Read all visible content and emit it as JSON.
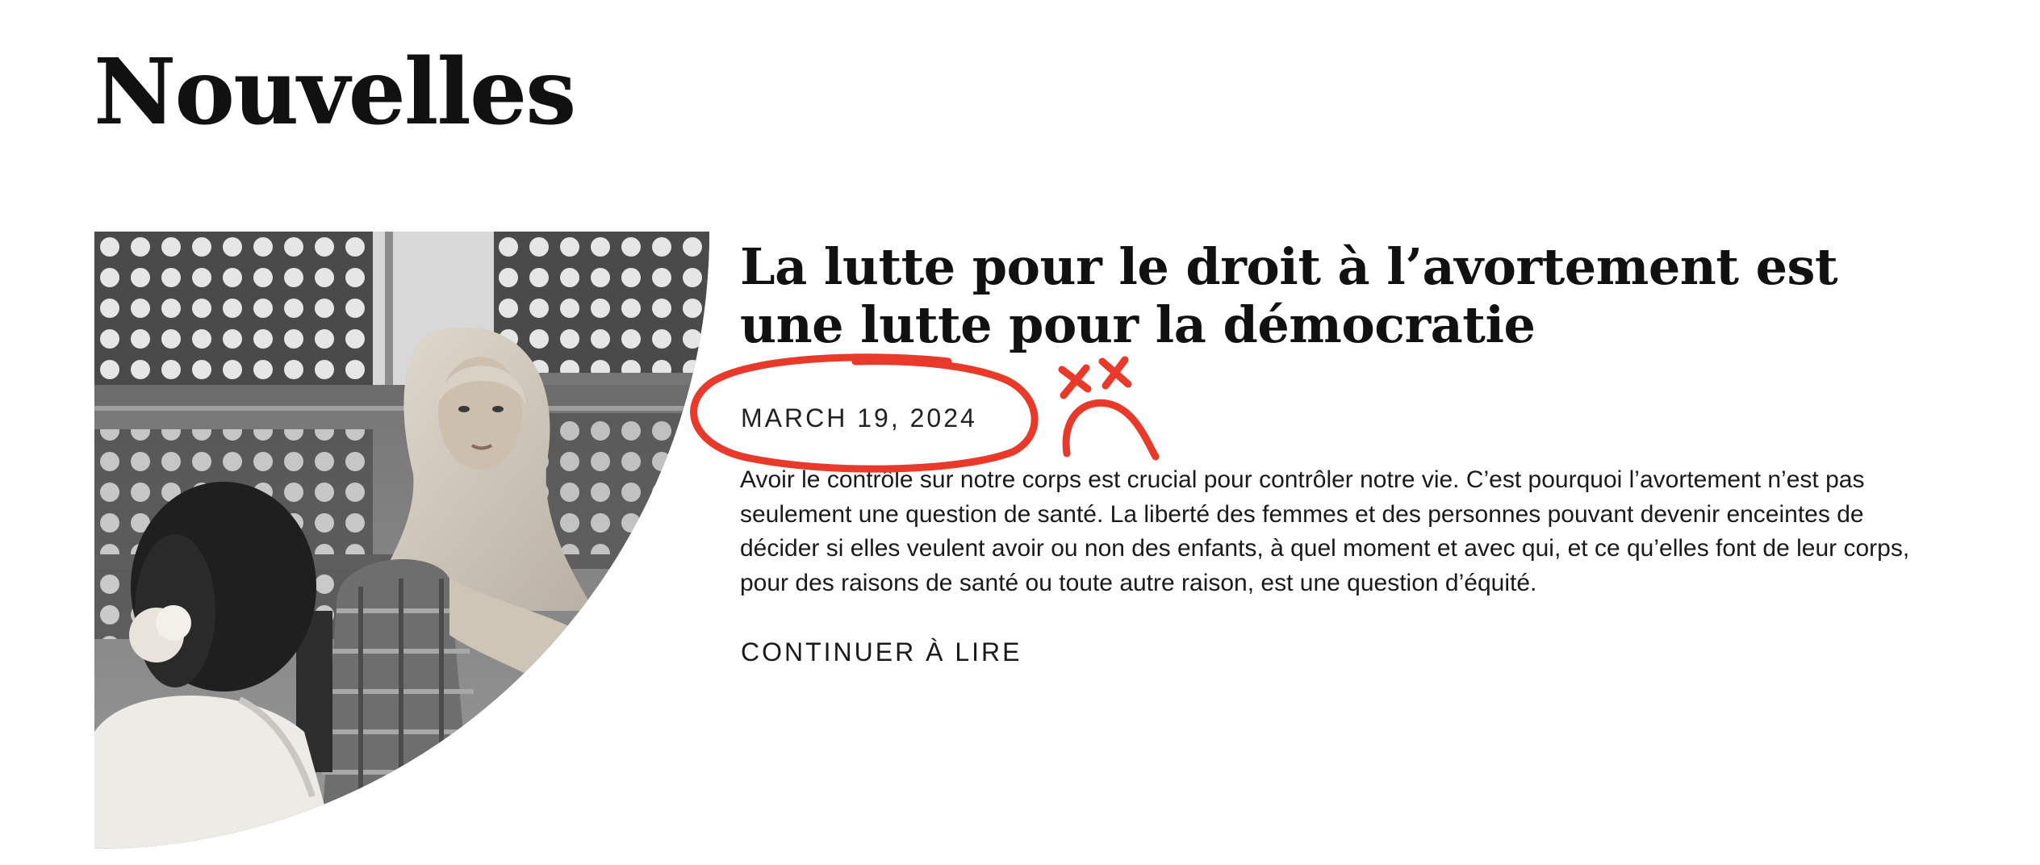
{
  "page": {
    "heading": "Nouvelles"
  },
  "article": {
    "title": "La lutte pour le droit à l’avortement est une lutte pour la démocratie",
    "date": "MARCH 19, 2024",
    "excerpt": "Avoir le contrôle sur notre corps est crucial pour contrôler notre vie. C’est pourquoi l’avortement n’est pas seulement une question de santé. La liberté des femmes et des personnes pouvant devenir enceintes de décider si elles veulent avoir ou non des enfants, à quel moment et avec qui, et ce qu’elles font de leur corps, pour des raisons de santé ou toute autre raison, est une question d’équité.",
    "read_more": "CONTINUER À LIRE",
    "image_description": "Two women in conversation, one wearing a hijab, in front of a perforated screen"
  },
  "annotations": {
    "color": "#e8392a",
    "circle": "red hand-drawn circle around the date",
    "face": "red hand-drawn sad face with crossed-out eyes"
  }
}
